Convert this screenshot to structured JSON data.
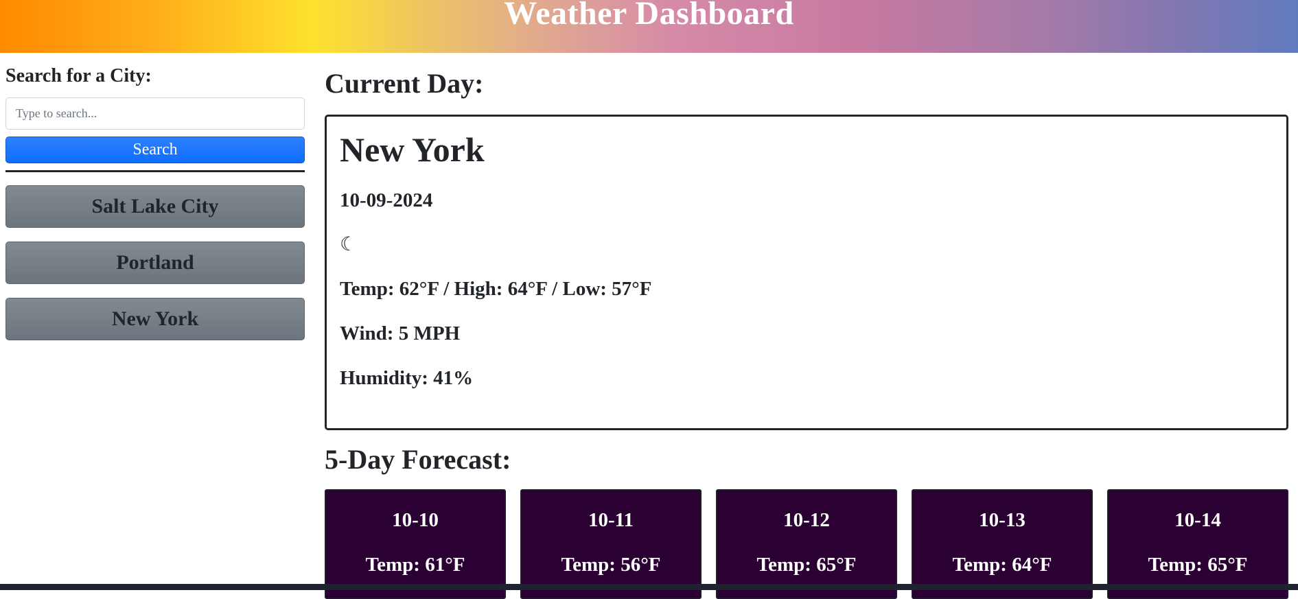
{
  "header": {
    "title": "Weather Dashboard"
  },
  "sidebar": {
    "search_label": "Search for a City:",
    "search_placeholder": "Type to search...",
    "search_value": "",
    "search_button": "Search",
    "history": [
      {
        "label": "Salt Lake City"
      },
      {
        "label": "Portland"
      },
      {
        "label": "New York"
      }
    ]
  },
  "current": {
    "heading": "Current Day:",
    "city": "New York",
    "date": "10-09-2024",
    "icon": "☾",
    "icon_name": "moon-icon",
    "temp": "Temp: 62°F / High: 64°F / Low: 57°F",
    "wind": "Wind: 5 MPH",
    "humidity": "Humidity: 41%"
  },
  "forecast": {
    "heading": "5-Day Forecast:",
    "days": [
      {
        "date": "10-10",
        "temp": "Temp: 61°F"
      },
      {
        "date": "10-11",
        "temp": "Temp: 56°F"
      },
      {
        "date": "10-12",
        "temp": "Temp: 65°F"
      },
      {
        "date": "10-13",
        "temp": "Temp: 64°F"
      },
      {
        "date": "10-14",
        "temp": "Temp: 65°F"
      }
    ]
  },
  "colors": {
    "search_button": "#0d6efd",
    "history_button": "#6c757d",
    "forecast_card": "#2b0033"
  }
}
